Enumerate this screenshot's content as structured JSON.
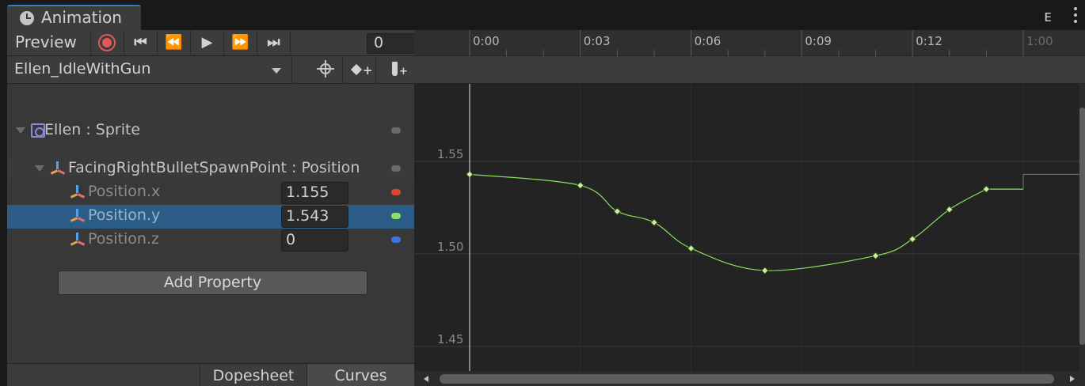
{
  "window": {
    "tab_title": "Animation",
    "tab_icon": "clock-icon",
    "accent_color": "#3a79bb"
  },
  "toolbar": {
    "preview_label": "Preview",
    "record_icon": "record-icon",
    "first_key_icon": "skip-to-start-icon",
    "prev_key_icon": "previous-key-icon",
    "play_icon": "play-icon",
    "next_key_icon": "next-key-icon",
    "last_key_icon": "skip-to-end-icon",
    "frame_value": "0",
    "record_color": "#e05858"
  },
  "clip_selector": {
    "selected": "Ellen_IdleWithGun",
    "keyframe_target_icon": "crosshair-icon",
    "add_keyframe_icon": "add-keyframe-icon",
    "add_event_icon": "add-event-icon"
  },
  "hierarchy": {
    "root": {
      "label": "Ellen : Sprite",
      "icon": "sprite-icon"
    },
    "child": {
      "label": "FacingRightBulletSpawnPoint : Position",
      "icon": "transform-axes-icon"
    },
    "properties": [
      {
        "label": "Position.x",
        "value": "1.155",
        "dot_color": "#e0442c",
        "selected": false
      },
      {
        "label": "Position.y",
        "value": "1.543",
        "dot_color": "#8ce060",
        "selected": true
      },
      {
        "label": "Position.z",
        "value": "0",
        "dot_color": "#3b74e0",
        "selected": false
      }
    ],
    "add_property_label": "Add Property"
  },
  "bottom_tabs": {
    "dopesheet_label": "Dopesheet",
    "curves_label": "Curves",
    "active": "Curves"
  },
  "timeline": {
    "tick_labels": [
      "0:00",
      "0:03",
      "0:06",
      "0:09",
      "0:12",
      "1:00"
    ],
    "value_labels": [
      "1.55",
      "1.50",
      "1.45"
    ]
  },
  "chart_data": {
    "type": "line",
    "series": [
      {
        "name": "Position.y",
        "color": "#8ce060",
        "keyframe_times": [
          "0:00",
          "0:03",
          "0:04",
          "0:05",
          "0:06",
          "0:08",
          "0:11",
          "0:12",
          "0:13",
          "0:14"
        ],
        "x": [
          0,
          3,
          4,
          5,
          6,
          8,
          11,
          12,
          13,
          14
        ],
        "y": [
          1.543,
          1.537,
          1.523,
          1.517,
          1.503,
          1.491,
          1.499,
          1.508,
          1.524,
          1.535
        ],
        "hold_until": 15,
        "x_after": 15,
        "y_after": 1.543
      }
    ],
    "xlim": [
      0,
      16
    ],
    "ylim": [
      1.43,
      1.6
    ],
    "grid": true
  }
}
